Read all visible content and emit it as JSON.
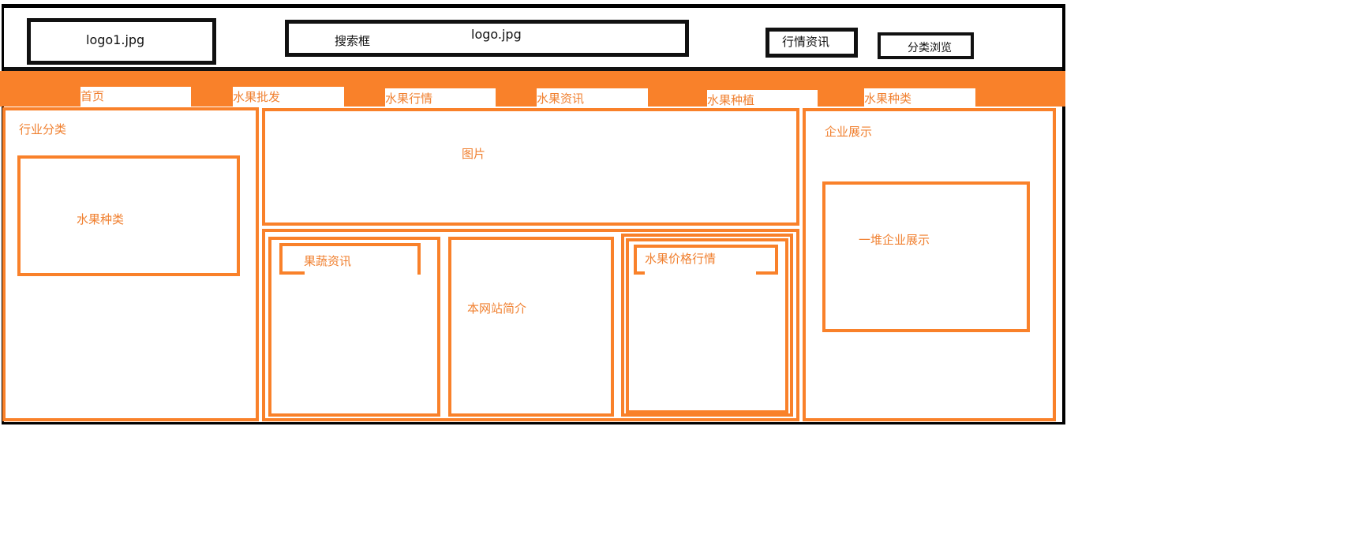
{
  "header": {
    "logo1": "logo1.jpg",
    "search": "搜索框",
    "logo": "logo.jpg",
    "news_button": "行情资讯",
    "browse_button": "分类浏览"
  },
  "nav": {
    "items": [
      {
        "label": "首页"
      },
      {
        "label": "水果批发"
      },
      {
        "label": "水果行情"
      },
      {
        "label": "水果资讯"
      },
      {
        "label": "水果种植"
      },
      {
        "label": "水果种类"
      }
    ]
  },
  "left_panel": {
    "title": "行业分类",
    "inner_label": "水果种类"
  },
  "center_panel": {
    "banner_label": "图片",
    "news_label": "果蔬资讯",
    "intro_label": "本网站简介",
    "price_label": "水果价格行情"
  },
  "right_panel": {
    "title": "企业展示",
    "inner_label": "一堆企业展示"
  }
}
